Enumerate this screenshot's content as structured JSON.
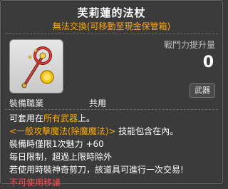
{
  "item": {
    "name": "芙莉蓮的法杖",
    "trade_note": "無法交換(可移動至現金保管箱)",
    "power_label": "戰鬥力提升量",
    "power_value": "0",
    "category": "武器",
    "job_label": "裝備職業",
    "job_value": "共用",
    "icon": "staff-icon"
  },
  "description": {
    "line1_prefix": "可套用在",
    "line1_highlight": "所有武器",
    "line1_suffix": "上。",
    "line2_highlight": "<一般攻擊魔法(除魔魔法)>",
    "line2_suffix": " 技能包含在內。",
    "line3": "裝備時僅限1次魅力 +60",
    "line4": "每日限制，超過上限時除外",
    "line5": "若使用時裝神奇剪刀，該道具可進行一次交易!",
    "line6": "不可使用移議"
  },
  "colors": {
    "highlight": "#ffaa00",
    "warning": "#ff4a4a"
  }
}
